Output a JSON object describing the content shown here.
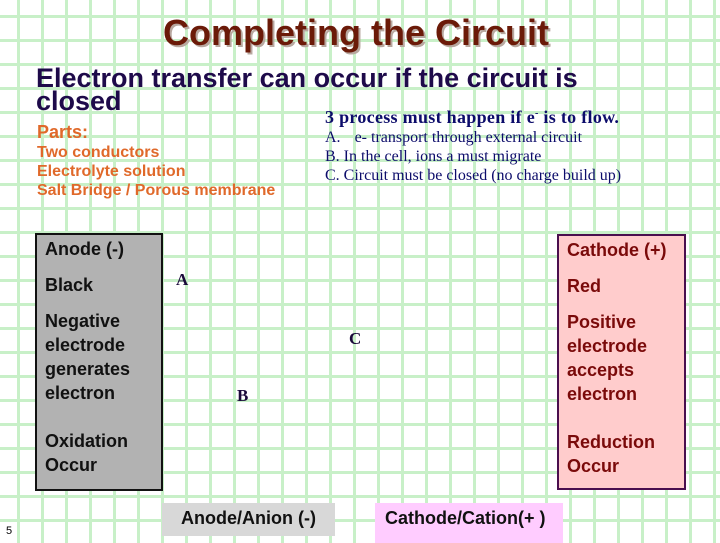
{
  "slide": {
    "title": "Completing the Circuit",
    "intro": "Electron transfer can occur if the circuit is closed",
    "page_number": "5"
  },
  "parts": {
    "heading": "Parts:",
    "items": [
      "Two conductors",
      "Electrolyte solution",
      "Salt Bridge / Porous membrane"
    ]
  },
  "process": {
    "heading_before": "3 process must happen if e",
    "heading_sup": "-",
    "heading_after": " is to flow.",
    "steps": [
      {
        "label": "A.",
        "text": "e- transport through external circuit"
      },
      {
        "label": "B.",
        "text": "In the cell, ions a must migrate"
      },
      {
        "label": "C.",
        "text": "Circuit must be closed (no charge build up)"
      }
    ]
  },
  "anode": {
    "title": "Anode (-)",
    "color_name": "Black",
    "description": [
      "Negative",
      "electrode",
      "generates",
      "electron"
    ],
    "reaction": [
      "Oxidation",
      "Occur"
    ],
    "fill": "#b2b2b2"
  },
  "cathode": {
    "title": "Cathode (+)",
    "color_name": "Red",
    "description": [
      "Positive",
      "electrode",
      "accepts",
      "electron"
    ],
    "reaction": [
      "Reduction",
      "Occur"
    ],
    "fill": "#ffcccc"
  },
  "markers": {
    "a": "A",
    "b": "B",
    "c": "C"
  },
  "ion_labels": {
    "anion": "Anode/Anion (-)",
    "cation": "Cathode/Cation(+ )"
  }
}
